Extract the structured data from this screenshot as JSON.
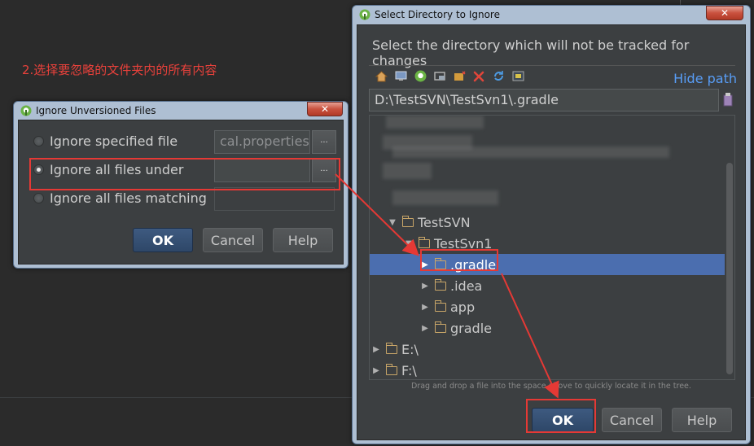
{
  "annotation": "2.选择要忽略的文件夹内的所有内容",
  "ignore_dialog": {
    "title": "Ignore Unversioned Files",
    "close_glyph": "✕",
    "options": [
      {
        "label": "Ignore specified file",
        "value": "cal.properties",
        "selected": false
      },
      {
        "label": "Ignore all files under",
        "value": "",
        "selected": true
      },
      {
        "label": "Ignore all files matching",
        "value": "",
        "selected": false
      }
    ],
    "browse_label": "...",
    "ok_label": "OK",
    "cancel_label": "Cancel",
    "help_label": "Help"
  },
  "select_dialog": {
    "title": "Select Directory to Ignore",
    "close_glyph": "✕",
    "description": "Select the directory which will not be tracked for changes",
    "toolbar_icons": [
      "home-icon",
      "desktop-icon",
      "android-project-icon",
      "module-icon",
      "new-folder-icon",
      "delete-icon",
      "refresh-icon",
      "show-hidden-icon"
    ],
    "hide_path_label": "Hide path",
    "path_value": "D:\\TestSVN\\TestSvn1\\.gradle",
    "tree": [
      {
        "label": "TestSVN",
        "expanded": true,
        "selected": false
      },
      {
        "label": "TestSvn1",
        "expanded": true,
        "selected": false
      },
      {
        "label": ".gradle",
        "expanded": false,
        "selected": true
      },
      {
        "label": ".idea",
        "expanded": false,
        "selected": false
      },
      {
        "label": "app",
        "expanded": false,
        "selected": false
      },
      {
        "label": "gradle",
        "expanded": false,
        "selected": false
      },
      {
        "label": "E:\\",
        "expanded": false,
        "selected": false
      },
      {
        "label": "F:\\",
        "expanded": false,
        "selected": false
      }
    ],
    "hint": "Drag and drop a file into the space above to quickly locate it in the tree.",
    "ok_label": "OK",
    "cancel_label": "Cancel",
    "help_label": "Help"
  },
  "colors": {
    "accent_red": "#e53935",
    "selection": "#4b6eaf",
    "link": "#589df6",
    "folder": "#c9a668"
  }
}
